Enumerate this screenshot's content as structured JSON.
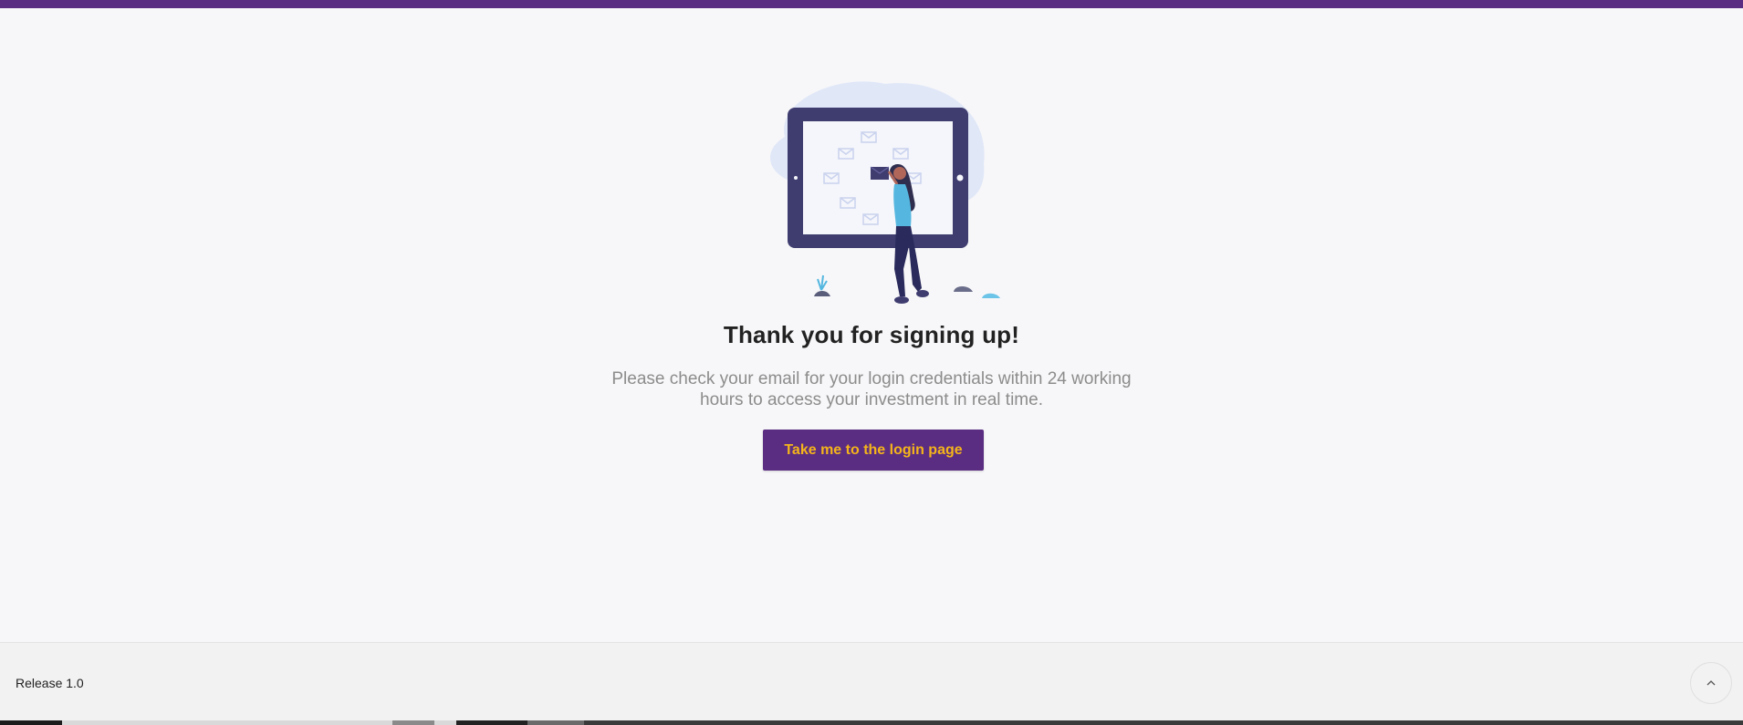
{
  "header": {
    "accent_color": "#5b2d82"
  },
  "illustration": {
    "icon": "woman-tablet-email-icon"
  },
  "main": {
    "title": "Thank you for signing up!",
    "message_line1": "Please check your email for your login credentials within 24 working",
    "message_line2": "hours to access your investment in real time.",
    "login_button_label": "Take me to the login page",
    "button_text_color": "#f4b41a"
  },
  "footer": {
    "release": "Release 1.0",
    "scroll_top_icon": "chevron-up-icon"
  }
}
